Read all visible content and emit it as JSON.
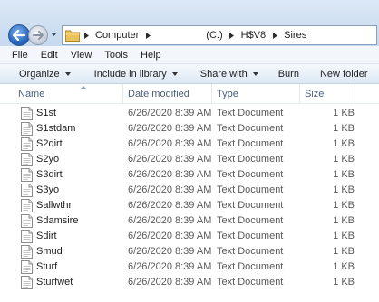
{
  "address": {
    "crumbs": [
      "Computer",
      "(C:)",
      "H$V8",
      "Sires"
    ]
  },
  "menu": [
    "File",
    "Edit",
    "View",
    "Tools",
    "Help"
  ],
  "toolbar": {
    "organize": "Organize",
    "include": "Include in library",
    "share": "Share with",
    "burn": "Burn",
    "new_folder": "New folder"
  },
  "columns": {
    "name": "Name",
    "date": "Date modified",
    "type": "Type",
    "size": "Size"
  },
  "files": [
    {
      "name": "S1st",
      "date": "6/26/2020 8:39 AM",
      "type": "Text Document",
      "size": "1 KB"
    },
    {
      "name": "S1stdam",
      "date": "6/26/2020 8:39 AM",
      "type": "Text Document",
      "size": "1 KB"
    },
    {
      "name": "S2dirt",
      "date": "6/26/2020 8:39 AM",
      "type": "Text Document",
      "size": "1 KB"
    },
    {
      "name": "S2yo",
      "date": "6/26/2020 8:39 AM",
      "type": "Text Document",
      "size": "1 KB"
    },
    {
      "name": "S3dirt",
      "date": "6/26/2020 8:39 AM",
      "type": "Text Document",
      "size": "1 KB"
    },
    {
      "name": "S3yo",
      "date": "6/26/2020 8:39 AM",
      "type": "Text Document",
      "size": "1 KB"
    },
    {
      "name": "Sallwthr",
      "date": "6/26/2020 8:39 AM",
      "type": "Text Document",
      "size": "1 KB"
    },
    {
      "name": "Sdamsire",
      "date": "6/26/2020 8:39 AM",
      "type": "Text Document",
      "size": "1 KB"
    },
    {
      "name": "Sdirt",
      "date": "6/26/2020 8:39 AM",
      "type": "Text Document",
      "size": "1 KB"
    },
    {
      "name": "Smud",
      "date": "6/26/2020 8:39 AM",
      "type": "Text Document",
      "size": "1 KB"
    },
    {
      "name": "Sturf",
      "date": "6/26/2020 8:39 AM",
      "type": "Text Document",
      "size": "1 KB"
    },
    {
      "name": "Sturfwet",
      "date": "6/26/2020 8:39 AM",
      "type": "Text Document",
      "size": "1 KB"
    }
  ],
  "icons": {
    "back": "back-arrow-icon",
    "forward": "forward-arrow-icon",
    "folder": "folder-icon",
    "file": "text-document-icon"
  },
  "colors": {
    "header_text": "#4c607a",
    "toolbar_bg": "#dde8f4",
    "nav_blue": "#2c6bc0"
  }
}
